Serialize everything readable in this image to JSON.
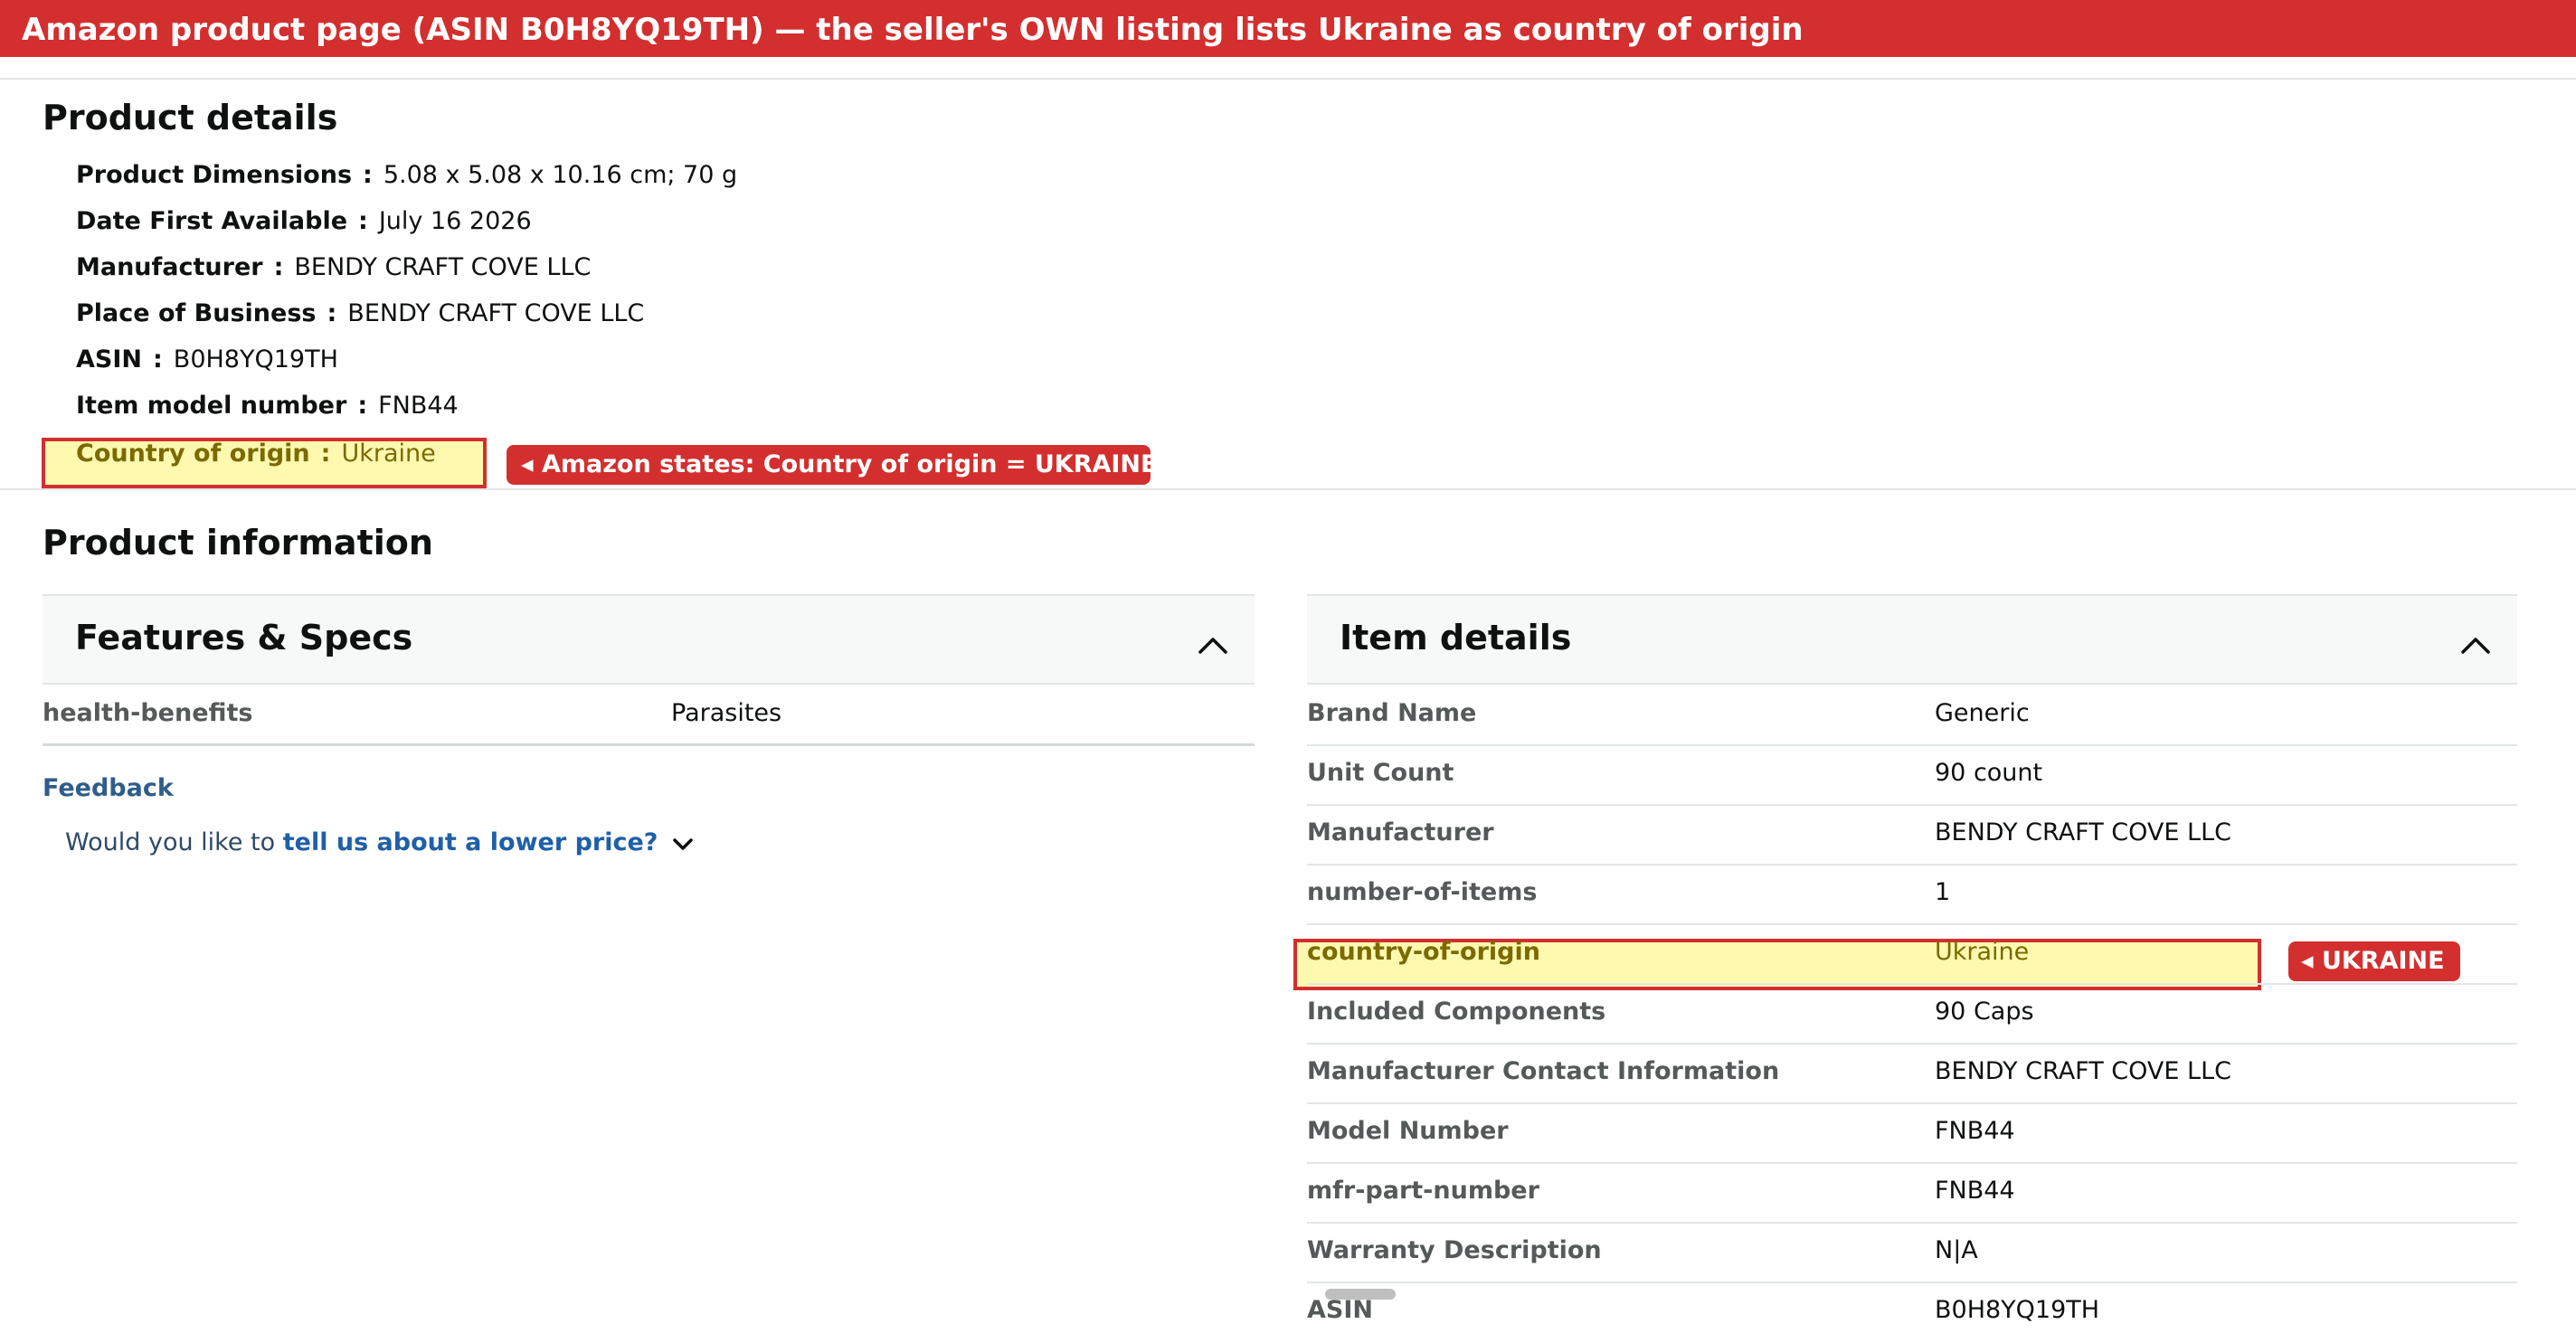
{
  "banner": "Amazon product page (ASIN B0H8YQ19TH) — the seller's OWN listing lists Ukraine as country of origin",
  "product_details": {
    "title": "Product details",
    "separator": ":",
    "rows": [
      {
        "key": "Product Dimensions",
        "value": "5.08 x 5.08 x 10.16 cm; 70 g"
      },
      {
        "key": "Date First Available",
        "value": "July 16 2026"
      },
      {
        "key": "Manufacturer",
        "value": "BENDY CRAFT COVE LLC"
      },
      {
        "key": "Place of Business",
        "value": "BENDY CRAFT COVE LLC"
      },
      {
        "key": "ASIN",
        "value": "B0H8YQ19TH"
      },
      {
        "key": "Item model number",
        "value": "FNB44"
      },
      {
        "key": "Country of origin",
        "value": "Ukraine",
        "highlighted": true
      }
    ],
    "callout": "◂ Amazon states: Country of origin = UKRAINE"
  },
  "product_information": {
    "title": "Product information",
    "features": {
      "title": "Features & Specs",
      "rows": [
        {
          "key": "health-benefits",
          "value": "Parasites"
        }
      ]
    },
    "feedback": {
      "label": "Feedback",
      "prompt": "Would you like to",
      "link": "tell us about a lower price?"
    },
    "item_details": {
      "title": "Item details",
      "rows": [
        {
          "key": "Brand Name",
          "value": "Generic"
        },
        {
          "key": "Unit Count",
          "value": "90 count"
        },
        {
          "key": "Manufacturer",
          "value": "BENDY CRAFT COVE LLC"
        },
        {
          "key": "number-of-items",
          "value": "1"
        },
        {
          "key": "country-of-origin",
          "value": "Ukraine",
          "highlighted": true
        },
        {
          "key": "Included Components",
          "value": "90 Caps"
        },
        {
          "key": "Manufacturer Contact Information",
          "value": "BENDY CRAFT COVE LLC"
        },
        {
          "key": "Model Number",
          "value": "FNB44"
        },
        {
          "key": "mfr-part-number",
          "value": "FNB44"
        },
        {
          "key": "Warranty Description",
          "value": "N|A"
        },
        {
          "key": "ASIN",
          "value": "B0H8YQ19TH"
        }
      ],
      "callout": "◂ UKRAINE"
    }
  },
  "colors": {
    "annotation_red": "#d32f2f",
    "highlight_yellow": "#fff9b0",
    "link_blue": "#1f5fa8"
  }
}
